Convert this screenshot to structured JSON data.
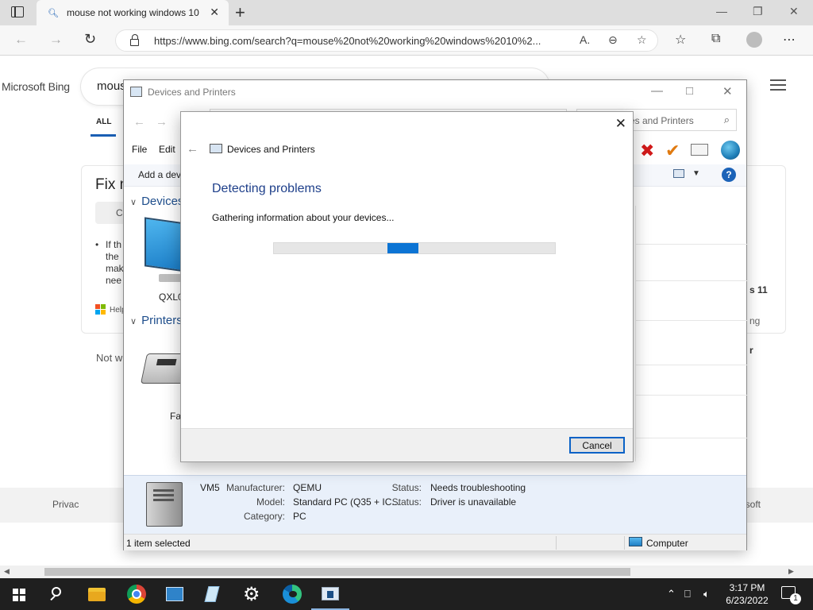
{
  "browser": {
    "tab_title": "mouse not working windows 10",
    "url": "https://www.bing.com/search?q=mouse%20not%20working%20windows%2010%2...",
    "new_tab_symbol": "+"
  },
  "bing": {
    "logo": "Microsoft Bing",
    "query_fragment": "mous",
    "scope_all": "ALL",
    "fix_fragment": "Fix n",
    "button_fragment": "C",
    "bullet_lines": [
      "If th",
      "the",
      "mak",
      "nee"
    ],
    "help_fragment": "Help",
    "not_what_fragment": "Not wh",
    "footer_privacy_fragment": "Privac",
    "footer_microsoft_fragment": "osoft",
    "right_fragments": [
      "s 11",
      "ng",
      "r"
    ]
  },
  "devices_window": {
    "title": "Devices and Printers",
    "search_placeholder": "ces and Printers",
    "menu": {
      "file": "File",
      "edit": "Edit"
    },
    "cmd_add": "Add a dev",
    "groups": {
      "devices": "Devices",
      "printers": "Printers"
    },
    "device_labels": {
      "computer": "QXL0",
      "fax": "Fa"
    },
    "details": {
      "name": "VM5",
      "manufacturer_label": "Manufacturer:",
      "manufacturer": "QEMU",
      "model_label": "Model:",
      "model": "Standard PC (Q35 + IC...",
      "category_label": "Category:",
      "category": "PC",
      "status_label": "Status:",
      "status1": "Needs troubleshooting",
      "status2": "Driver is unavailable"
    },
    "statusbar": {
      "selected": "1 item selected",
      "location": "Computer"
    }
  },
  "dialog": {
    "app_title": "Devices and Printers",
    "heading": "Detecting problems",
    "message": "Gathering information about your devices...",
    "cancel": "Cancel",
    "progress_fraction": 0.11,
    "progress_offset_fraction": 0.405
  },
  "taskbar": {
    "time": "3:17 PM",
    "date": "6/23/2022",
    "notification_count": "1"
  },
  "colors": {
    "accent": "#0c74d4",
    "heading_blue": "#1e3f8a",
    "taskbar": "#1f1f1f"
  }
}
